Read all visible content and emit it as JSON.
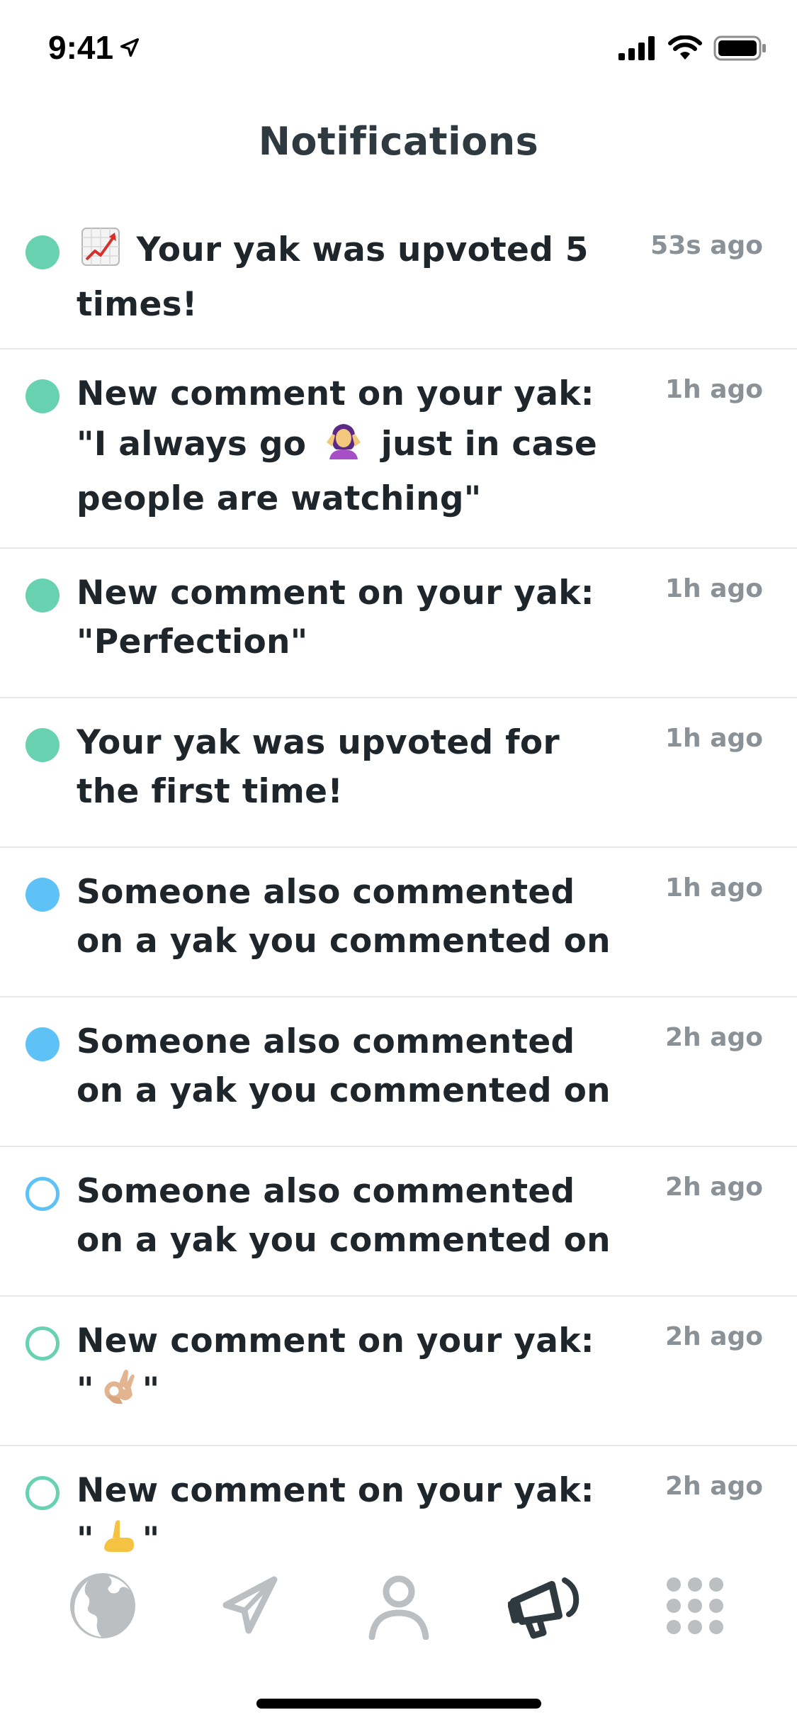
{
  "status_bar": {
    "time": "9:41"
  },
  "header": {
    "title": "Notifications"
  },
  "notifications": [
    {
      "prefix": "",
      "text": "Your yak was upvoted 5 times!",
      "time": "53s ago",
      "dot": "green",
      "emoji": "chart-increasing-icon"
    },
    {
      "prefix": "New comment on your yak: \"I always go",
      "suffix": "just in case people are watching\"",
      "time": "1h ago",
      "dot": "green",
      "emoji": "person-shrugging-icon"
    },
    {
      "text": "New comment on your yak: \"Perfection\"",
      "time": "1h ago",
      "dot": "green"
    },
    {
      "text": "Your yak was upvoted for the first time!",
      "time": "1h ago",
      "dot": "green"
    },
    {
      "text": "Someone also commented on a yak you commented on",
      "time": "1h ago",
      "dot": "blue"
    },
    {
      "text": "Someone also commented on a yak you commented on",
      "time": "2h ago",
      "dot": "blue"
    },
    {
      "text": "Someone also commented on a yak you commented on",
      "time": "2h ago",
      "dot": "hollow-blue"
    },
    {
      "prefix": "New comment on your yak:",
      "quote_open": "\"",
      "quote_close": "\"",
      "time": "2h ago",
      "dot": "hollow-green",
      "emoji": "ok-hand-icon"
    },
    {
      "prefix": "New comment on your yak:",
      "quote_open": "\"",
      "quote_close": "\"",
      "time": "2h ago",
      "dot": "hollow-green",
      "emoji": "pinching-hand-icon"
    }
  ],
  "tabs": [
    {
      "name": "feed-tab",
      "icon": "globe-icon",
      "active": false
    },
    {
      "name": "post-tab",
      "icon": "paper-plane-icon",
      "active": false
    },
    {
      "name": "profile-tab",
      "icon": "person-icon",
      "active": false
    },
    {
      "name": "notifications-tab",
      "icon": "megaphone-icon",
      "active": true
    },
    {
      "name": "more-tab",
      "icon": "grid-icon",
      "active": false
    }
  ],
  "colors": {
    "green": "#68d2b0",
    "blue": "#5ec2f6",
    "text": "#1f262b",
    "muted": "#8a9197",
    "tab_inactive": "#bcbfc2",
    "tab_active": "#2f3a40"
  }
}
